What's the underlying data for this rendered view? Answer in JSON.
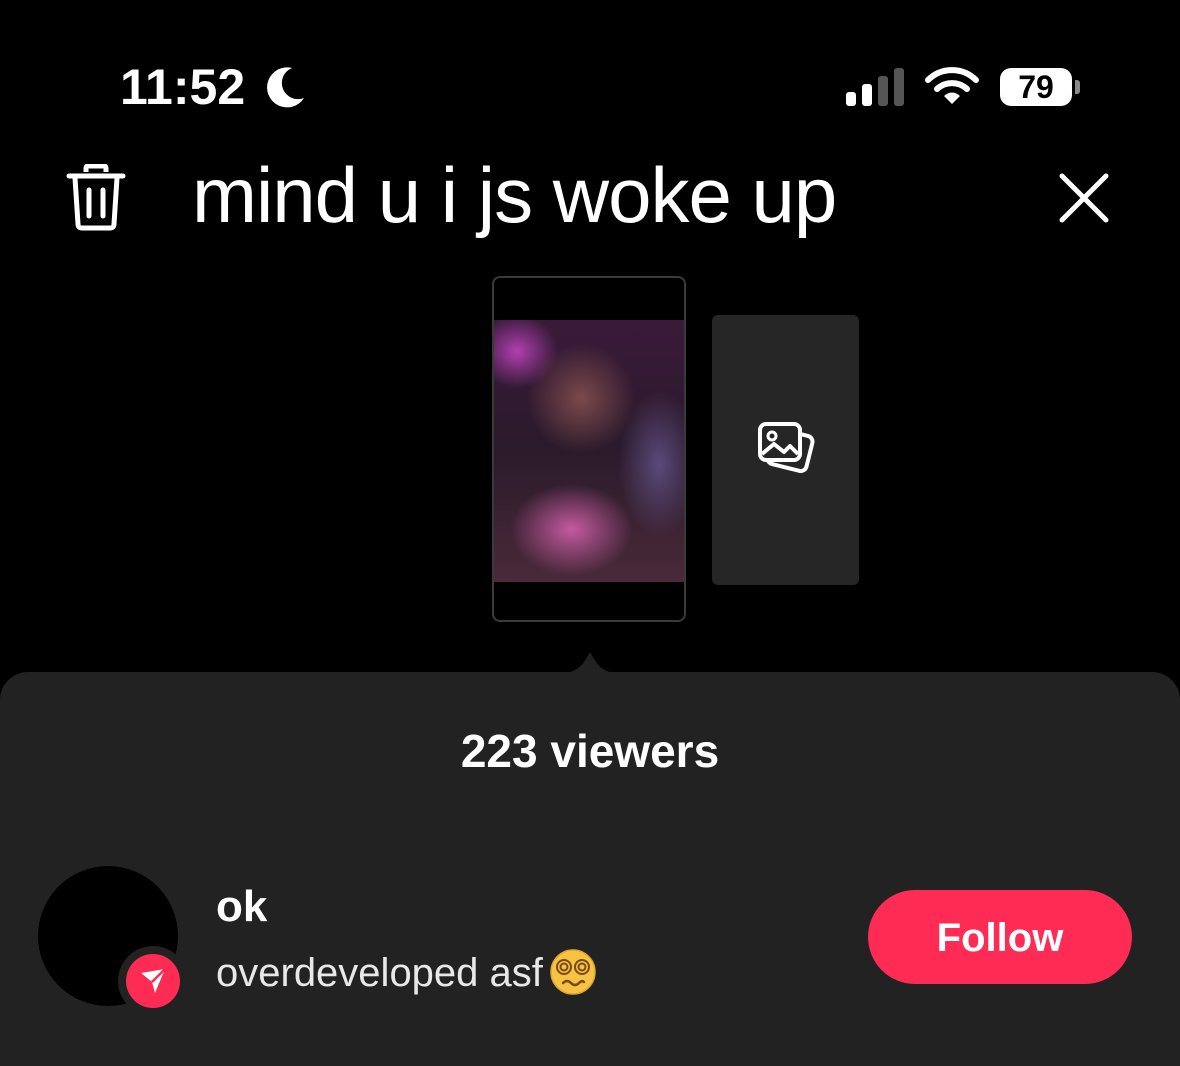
{
  "status_bar": {
    "time": "11:52",
    "battery": "79",
    "icons": [
      "moon-icon",
      "cellular-signal-icon",
      "wifi-icon",
      "battery-icon"
    ]
  },
  "header": {
    "title": "mind u i js woke up",
    "delete_icon": "trash-icon",
    "close_icon": "close-icon"
  },
  "stories": {
    "selected_thumbnail": "story-thumbnail",
    "add_icon": "photo-gallery-icon"
  },
  "sheet": {
    "viewers_label": "223 viewers",
    "viewer": {
      "username": "ok",
      "bio": "overdeveloped asf",
      "bio_emoji": "dizzy-face-emoji",
      "follow_label": "Follow",
      "badge_icon": "share-arrow-icon"
    }
  },
  "colors": {
    "background": "#000000",
    "sheet": "#222222",
    "accent": "#fe2c55"
  }
}
